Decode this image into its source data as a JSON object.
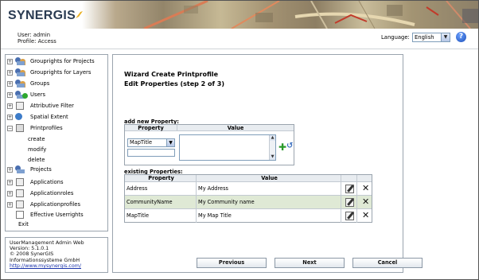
{
  "app": {
    "logo": "SYNERGIS"
  },
  "userbar": {
    "user": "User: admin",
    "profile": "Profile: Access",
    "language_label": "Language:",
    "language_value": "English"
  },
  "sidebar": {
    "items": [
      {
        "label": "Grouprights for Projects",
        "expander": "+"
      },
      {
        "label": "Grouprights for Layers",
        "expander": "+"
      },
      {
        "label": "Groups",
        "expander": "+"
      },
      {
        "label": "Users",
        "expander": "+"
      },
      {
        "label": "Attributive Filter",
        "expander": "+"
      },
      {
        "label": "Spatial Extent",
        "expander": "+"
      },
      {
        "label": "Printprofiles",
        "expander": "−"
      }
    ],
    "subitems": [
      "create",
      "modify",
      "delete"
    ],
    "items2": [
      {
        "label": "Projects",
        "expander": "+"
      },
      {
        "label": "Applications",
        "expander": "+"
      },
      {
        "label": "Applicationroles",
        "expander": "+"
      },
      {
        "label": "Applicationprofiles",
        "expander": "+"
      },
      {
        "label": "Effective Userrights",
        "expander": ""
      }
    ],
    "exit": "Exit"
  },
  "sidebar_footer": {
    "line1": "UserManagement Admin Web",
    "line2": "Version: 5.1.0.1",
    "line3": "© 2008 SynerGIS",
    "line4": "Informationssysteme GmbH",
    "link": "http://www.mysynergis.com/"
  },
  "wizard": {
    "title": "Wizard Create Printprofile",
    "subtitle": "Edit Properties (step 2 of 3)",
    "add_label": "add new Property:",
    "add_header_property": "Property",
    "add_header_value": "Value",
    "property_select": "MapTitle",
    "existing_label": "existing Properties:",
    "existing_header_property": "Property",
    "existing_header_value": "Value",
    "existing_rows": [
      {
        "property": "Address",
        "value": "My Address"
      },
      {
        "property": "CommunityName",
        "value": "My Community name"
      },
      {
        "property": "MapTitle",
        "value": "My Map Title"
      }
    ],
    "buttons": {
      "previous": "Previous",
      "next": "Next",
      "cancel": "Cancel"
    }
  }
}
